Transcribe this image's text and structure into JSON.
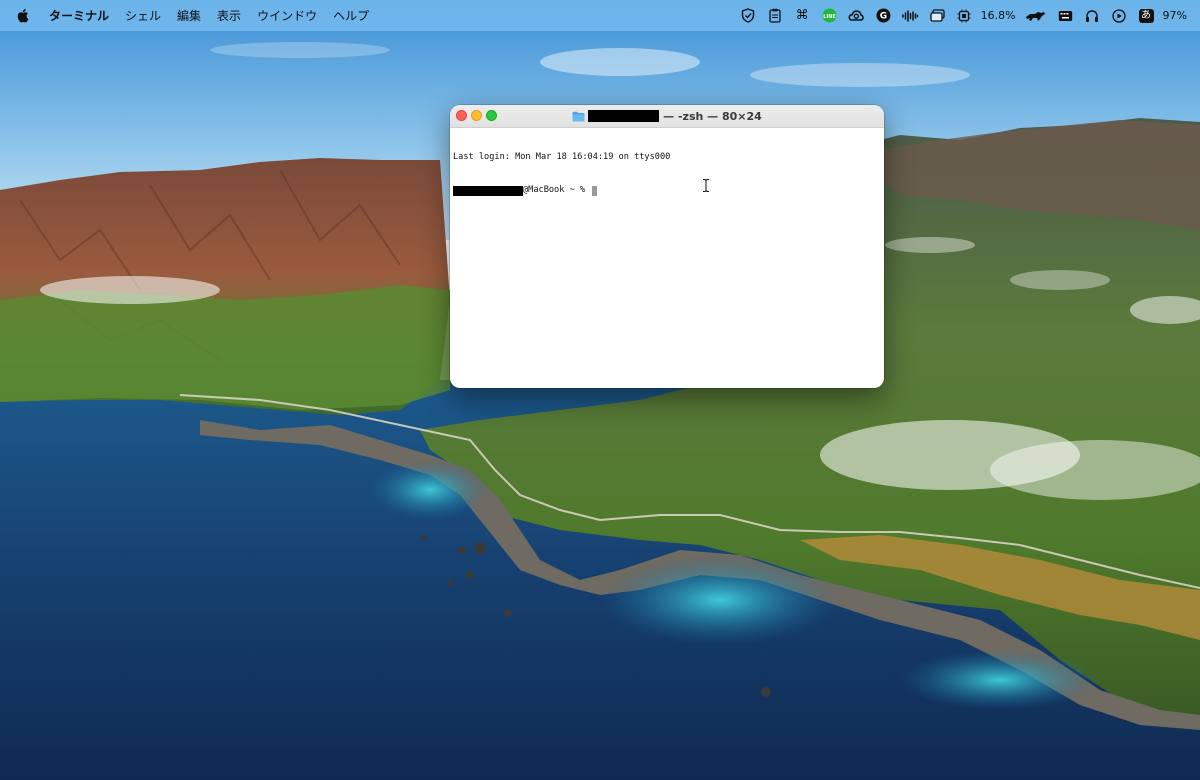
{
  "menubar": {
    "apple_icon": "apple-logo-icon",
    "app_name": "ターミナル",
    "menus": [
      "シェル",
      "編集",
      "表示",
      "ウインドウ",
      "ヘルプ"
    ],
    "status_items": {
      "cpu_temp_text": "16.8%",
      "battery_text": "97%",
      "input_method_text": "あ"
    }
  },
  "terminal": {
    "title_suffix": "— -zsh — 80×24",
    "last_login": "Last login: Mon Mar 18 16:04:19 on ttys000",
    "prompt_suffix": "@MacBook ~ % "
  },
  "colors": {
    "menubar_bg": "#78bef0",
    "close": "#fe5f57",
    "minimize": "#febc2e",
    "zoom": "#28c840"
  }
}
